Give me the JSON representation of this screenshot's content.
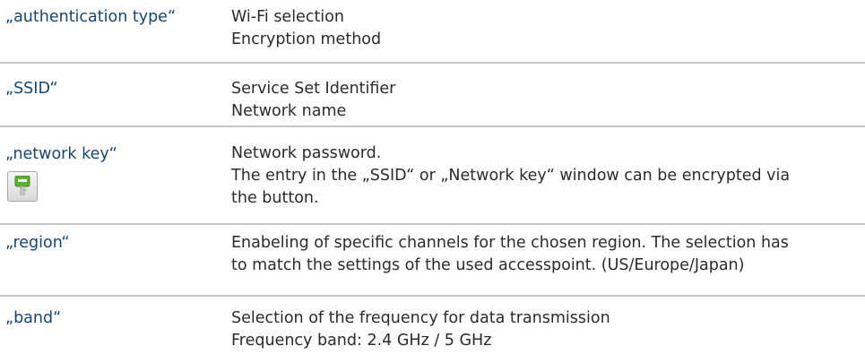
{
  "rows": [
    {
      "term": "„authentication type“",
      "description": [
        "Wi-Fi selection",
        "Encryption method"
      ]
    },
    {
      "term": "„SSID“",
      "description": [
        "Service Set Identifier",
        "Network name"
      ]
    },
    {
      "term": "„network key“",
      "description": [
        "Network password.",
        "The entry in the „SSID“ or „Network key“ window can be encrypted via",
        "the button."
      ],
      "icon": "key-icon"
    },
    {
      "term": "„region“",
      "description": [
        "Enabeling of specific channels for the chosen region. The selection has",
        "to match the settings of the used accesspoint. (US/Europe/Japan)"
      ]
    },
    {
      "term": "„band“",
      "description": [
        "Selection of the frequency for data transmission",
        "Frequency band: 2.4 GHz / 5 GHz"
      ]
    }
  ],
  "colors": {
    "term": "#17466f",
    "description": "#2b2b2b",
    "divider": "#c6c6c6",
    "key_green": "#5bb030"
  }
}
